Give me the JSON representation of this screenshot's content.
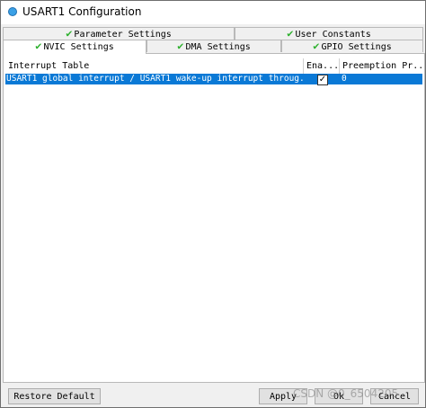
{
  "window": {
    "title": "USART1 Configuration"
  },
  "tabs": {
    "row1": [
      "Parameter Settings",
      "User Constants"
    ],
    "row2": [
      "NVIC Settings",
      "DMA Settings",
      "GPIO Settings"
    ],
    "active": "NVIC Settings"
  },
  "table": {
    "headers": [
      "Interrupt Table",
      "Ena...",
      "Preemption Pr..."
    ],
    "rows": [
      {
        "name": "USART1 global interrupt / USART1 wake-up interrupt throug...",
        "enabled": true,
        "preemption": "0"
      }
    ]
  },
  "buttons": {
    "restore": "Restore Default",
    "apply": "Apply",
    "ok": "Ok",
    "cancel": "Cancel"
  },
  "watermark": "CSDN @0_6504205"
}
